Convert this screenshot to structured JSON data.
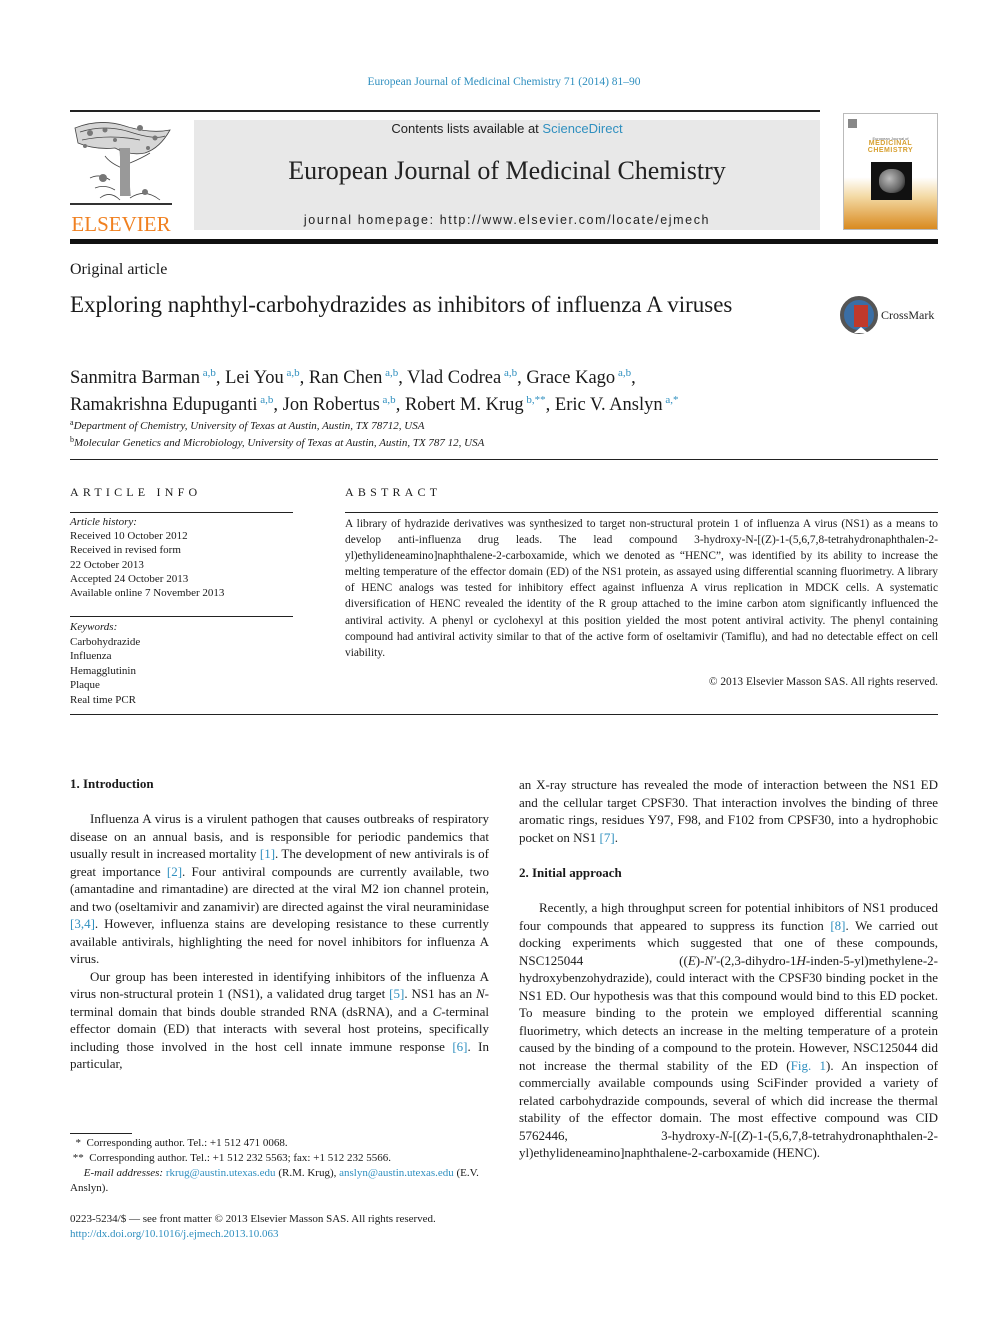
{
  "header": {
    "journal_reference": "European Journal of Medicinal Chemistry 71 (2014) 81–90",
    "contents_prefix": "Contents lists available at ",
    "contents_link": "ScienceDirect",
    "journal_title": "European Journal of Medicinal Chemistry",
    "homepage_label": "journal homepage: http://www.elsevier.com/locate/ejmech",
    "publisher_logo_text": "ELSEVIER",
    "cover_small_title": "European Journal of",
    "cover_title_line1": "MEDICINAL",
    "cover_title_line2": "CHEMISTRY",
    "crossmark_label": "CrossMark",
    "colors": {
      "link": "#2f8fbf",
      "elsevier_orange": "#f08020",
      "header_box": "#e8e8e8",
      "crossmark_red": "#c0392b"
    }
  },
  "article": {
    "type": "Original article",
    "title": "Exploring naphthyl-carbohydrazides as inhibitors of influenza A viruses",
    "authors": [
      {
        "name": "Sanmitra Barman",
        "aff": "a,b",
        "sep": ", "
      },
      {
        "name": "Lei You",
        "aff": "a,b",
        "sep": ", "
      },
      {
        "name": "Ran Chen",
        "aff": "a,b",
        "sep": ", "
      },
      {
        "name": "Vlad Codrea",
        "aff": "a,b",
        "sep": ", "
      },
      {
        "name": "Grace Kago",
        "aff": "a,b",
        "sep": ","
      },
      {
        "name": "Ramakrishna Edupuganti",
        "aff": "a,b",
        "sep": ", "
      },
      {
        "name": "Jon Robertus",
        "aff": "a,b",
        "sep": ", "
      },
      {
        "name": "Robert M. Krug",
        "aff": "b,**",
        "sep": ", "
      },
      {
        "name": "Eric V. Anslyn",
        "aff": "a,*",
        "sep": ""
      }
    ],
    "affiliations": [
      {
        "mark": "a",
        "text": "Department of Chemistry, University of Texas at Austin, Austin, TX 78712, USA"
      },
      {
        "mark": "b",
        "text": "Molecular Genetics and Microbiology, University of Texas at Austin, Austin, TX 787 12, USA"
      }
    ]
  },
  "article_info": {
    "label": "ARTICLE INFO",
    "history_label": "Article history:",
    "history": [
      "Received 10 October 2012",
      "Received in revised form",
      "22 October 2013",
      "Accepted 24 October 2013",
      "Available online 7 November 2013"
    ],
    "keywords_label": "Keywords:",
    "keywords": [
      "Carbohydrazide",
      "Influenza",
      "Hemagglutinin",
      "Plaque",
      "Real time PCR"
    ]
  },
  "abstract": {
    "label": "ABSTRACT",
    "text": "A library of hydrazide derivatives was synthesized to target non-structural protein 1 of influenza A virus (NS1) as a means to develop anti-influenza drug leads. The lead compound 3-hydroxy-N-[(Z)-1-(5,6,7,8-tetrahydronaphthalen-2-yl)ethylideneamino]naphthalene-2-carboxamide, which we denoted as “HENC”, was identified by its ability to increase the melting temperature of the effector domain (ED) of the NS1 protein, as assayed using differential scanning fluorimetry. A library of HENC analogs was tested for inhibitory effect against influenza A virus replication in MDCK cells. A systematic diversification of HENC revealed the identity of the R group attached to the imine carbon atom significantly influenced the antiviral activity. A phenyl or cyclohexyl at this position yielded the most potent antiviral activity. The phenyl containing compound had antiviral activity similar to that of the active form of oseltamivir (Tamiflu), and had no detectable effect on cell viability.",
    "copyright": "© 2013 Elsevier Masson SAS. All rights reserved."
  },
  "body": {
    "intro_heading": "1.  Introduction",
    "intro_p1": [
      {
        "t": "Influenza A virus is a virulent pathogen that causes outbreaks of respiratory disease on an annual basis, and is responsible for periodic pandemics that usually result in increased mortality "
      },
      {
        "c": "[1]"
      },
      {
        "t": ". The development of new antivirals is of great importance "
      },
      {
        "c": "[2]"
      },
      {
        "t": ". Four antiviral compounds are currently available, two (amantadine and rimantadine) are directed at the viral M2 ion channel protein, and two (oseltamivir and zanamivir) are directed against the viral neuraminidase "
      },
      {
        "c": "[3,4]"
      },
      {
        "t": ". However, influenza stains are developing resistance to these currently available antivirals, highlighting the need for novel inhibitors for influenza A virus."
      }
    ],
    "intro_p2": [
      {
        "t": "Our group has been interested in identifying inhibitors of the influenza A virus non-structural protein 1 (NS1), a validated drug target "
      },
      {
        "c": "[5]"
      },
      {
        "t": ". NS1 has an "
      },
      {
        "i": "N"
      },
      {
        "t": "-terminal domain that binds double stranded RNA (dsRNA), and a "
      },
      {
        "i": "C"
      },
      {
        "t": "-terminal effector domain (ED) that interacts with several host proteins, specifically including those involved in the host cell innate immune response "
      },
      {
        "c": "[6]"
      },
      {
        "t": ". In particular,"
      }
    ],
    "right_p0": [
      {
        "t": "an X-ray structure has revealed the mode of interaction between the NS1 ED and the cellular target CPSF30. That interaction involves the binding of three aromatic rings, residues Y97, F98, and F102 from CPSF30, into a hydrophobic pocket on NS1 "
      },
      {
        "c": "[7]"
      },
      {
        "t": "."
      }
    ],
    "approach_heading": "2.  Initial approach",
    "approach_p1": [
      {
        "t": "Recently, a high throughput screen for potential inhibitors of NS1 produced four compounds that appeared to suppress its function "
      },
      {
        "c": "[8]"
      },
      {
        "t": ". We carried out docking experiments which suggested that one of these compounds, NSC125044 (("
      },
      {
        "i": "E"
      },
      {
        "t": ")-"
      },
      {
        "i": "N′"
      },
      {
        "t": "-(2,3-dihydro-1"
      },
      {
        "i": "H"
      },
      {
        "t": "-inden-5-yl)methylene-2-hydroxybenzohydrazide), could interact with the CPSF30 binding pocket in the NS1 ED. Our hypothesis was that this compound would bind to this ED pocket. To measure binding to the protein we employed differential scanning fluorimetry, which detects an increase in the melting temperature of a protein caused by the binding of a compound to the protein. However, NSC125044 did not increase the thermal stability of the ED ("
      },
      {
        "c": "Fig. 1"
      },
      {
        "t": "). An inspection of commercially available compounds using SciFinder provided a variety of related carbohydrazide compounds, several of which did increase the thermal stability of the effector domain. The most effective compound was CID 5762446, 3-hydroxy-"
      },
      {
        "i": "N"
      },
      {
        "t": "-[("
      },
      {
        "i": "Z"
      },
      {
        "t": ")-1-(5,6,7,8-tetrahydronaphthalen-2-yl)ethylideneamino]naphthalene-2-carboxamide (HENC)."
      }
    ]
  },
  "footnotes": {
    "fn1_mark": "*",
    "fn1": "Corresponding author. Tel.: +1 512 471 0068.",
    "fn2_mark": "**",
    "fn2": "Corresponding author. Tel.: +1 512 232 5563; fax: +1 512 232 5566.",
    "email_label": "E-mail addresses:",
    "email1": "rkrug@austin.utexas.edu",
    "email1_owner": " (R.M. Krug), ",
    "email2": "anslyn@austin.utexas.edu",
    "email2_owner": " (E.V. Anslyn).",
    "front_matter": "0223-5234/$ — see front matter © 2013 Elsevier Masson SAS. All rights reserved.",
    "doi": "http://dx.doi.org/10.1016/j.ejmech.2013.10.063"
  }
}
